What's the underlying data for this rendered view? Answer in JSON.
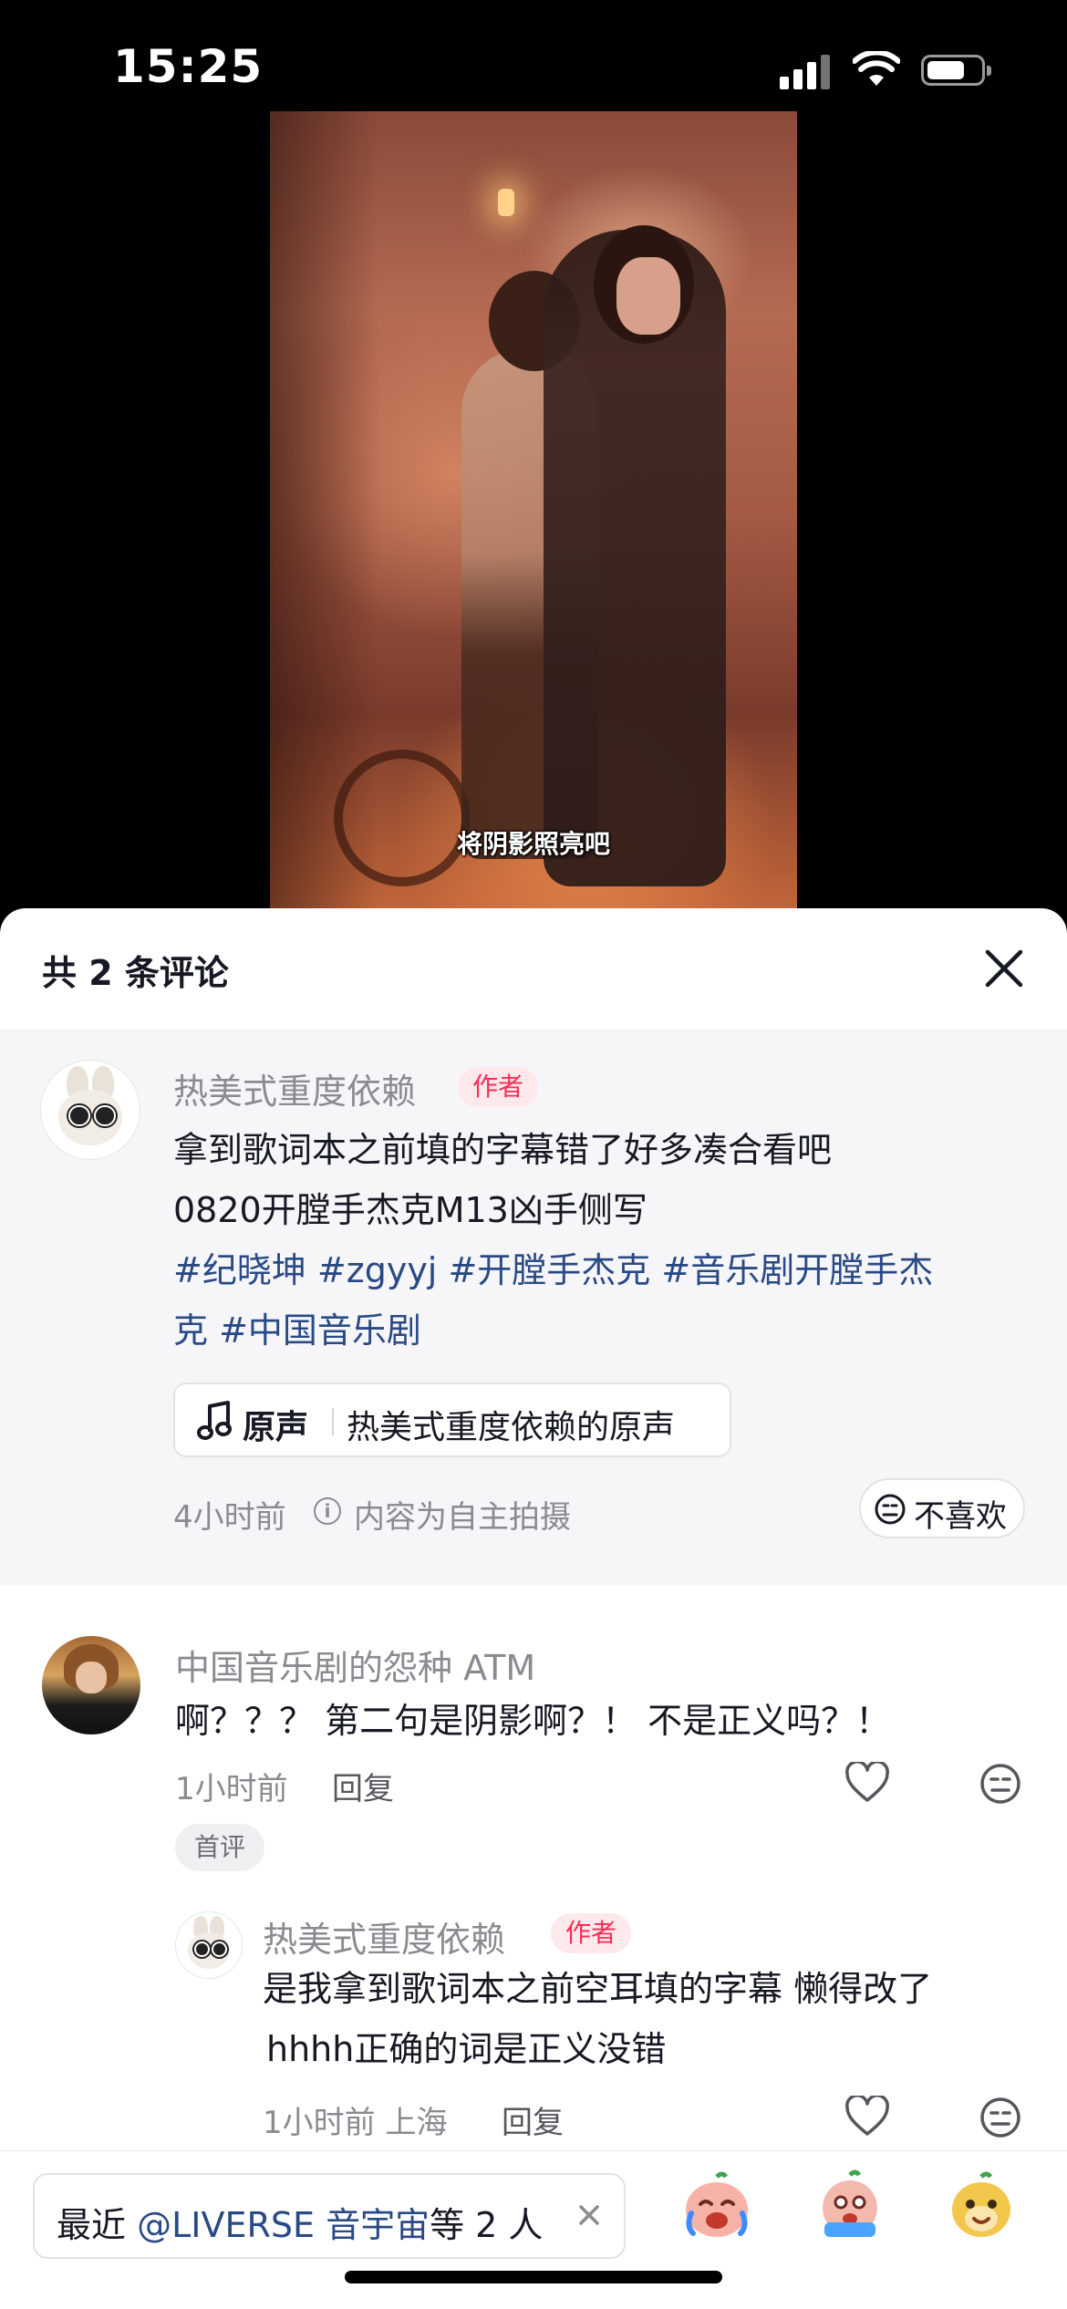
{
  "status_bar": {
    "time": "15:25"
  },
  "video": {
    "subtitle": "将阴影照亮吧"
  },
  "panel": {
    "title": "共 2 条评论"
  },
  "author_post": {
    "username": "热美式重度依赖",
    "tag": "作者",
    "text_line1": "拿到歌词本之前填的字幕错了好多凑合看吧",
    "text_line2": "0820开膛手杰克M13凶手侧写",
    "hashtags_line1": "#纪晓坤 #zgyyj #开膛手杰克 #音乐剧开膛手杰",
    "hashtags_line2": "克 #中国音乐剧",
    "music_label": "原声",
    "music_source": "热美式重度依赖的原声",
    "time": "4小时前",
    "notice": "内容为自主拍摄",
    "dislike_label": "不喜欢"
  },
  "comments": [
    {
      "username": "中国音乐剧的怨种 ATM",
      "text": "啊？？？ 第二句是阴影啊？！ 不是正义吗？！",
      "time": "1小时前",
      "reply_label": "回复",
      "badge": "首评"
    }
  ],
  "reply": {
    "username": "热美式重度依赖",
    "tag": "作者",
    "text_line1": "是我拿到歌词本之前空耳填的字幕 懒得改了",
    "text_line2": "hhhh正确的词是正义没错",
    "time_location": "1小时前 上海",
    "reply_label": "回复"
  },
  "bottom_bar": {
    "mention_prefix": "最近 ",
    "mention_handle": "@LIVERSE 音宇宙",
    "mention_suffix": "等 2 人"
  },
  "icons": {
    "close": "close-icon",
    "music": "music-note-icon",
    "info": "info-icon",
    "dislike": "meh-face-icon",
    "like": "heart-icon",
    "emojis": [
      "crying-emoji",
      "sobbing-emoji",
      "smiling-emoji"
    ]
  },
  "colors": {
    "author_tag": "#fe2c55",
    "hashtag": "#2a4a85",
    "muted": "#8a8b91"
  }
}
